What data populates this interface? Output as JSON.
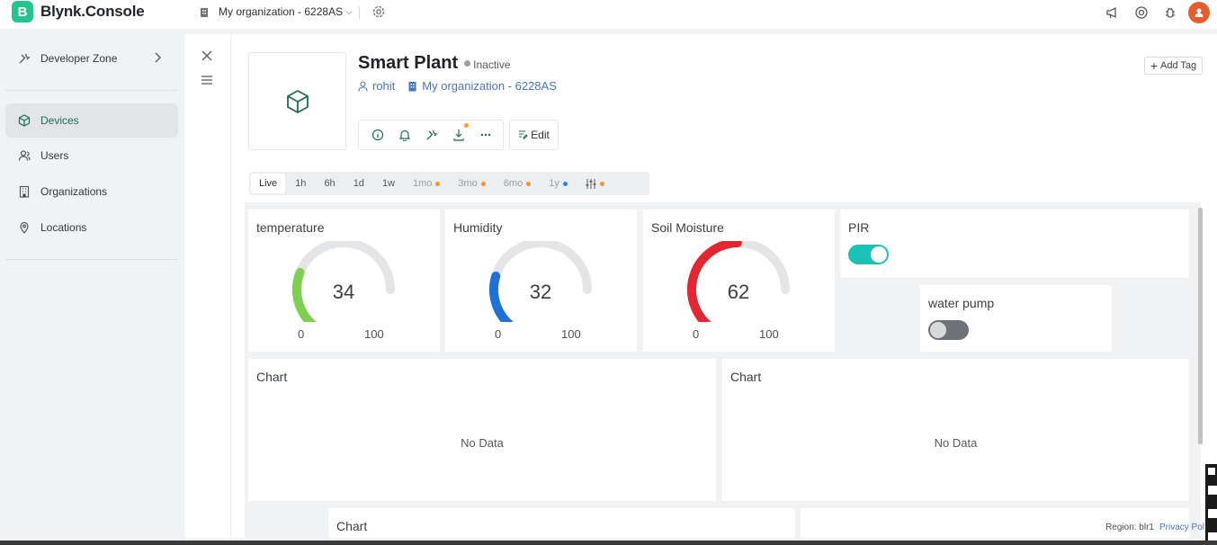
{
  "app": {
    "logo_letter": "B",
    "name": "Blynk.Console"
  },
  "topbar": {
    "organization": "My organization - 6228AS"
  },
  "sidebar": {
    "developer_zone": "Developer Zone",
    "items": [
      {
        "label": "Devices",
        "active": true
      },
      {
        "label": "Users"
      },
      {
        "label": "Organizations"
      },
      {
        "label": "Locations"
      }
    ]
  },
  "device": {
    "name": "Smart Plant",
    "status": "Inactive",
    "owner": "rohit",
    "organization": "My organization - 6228AS",
    "edit_label": "Edit",
    "add_tag_label": "Add Tag"
  },
  "time_tabs": [
    {
      "label": "Live",
      "active": true
    },
    {
      "label": "1h"
    },
    {
      "label": "6h"
    },
    {
      "label": "1d"
    },
    {
      "label": "1w"
    },
    {
      "label": "1mo",
      "dot": "#f0962a",
      "dim": true
    },
    {
      "label": "3mo",
      "dot": "#f0962a",
      "dim": true
    },
    {
      "label": "6mo",
      "dot": "#f0962a",
      "dim": true
    },
    {
      "label": "1y",
      "dot": "#2f80ed",
      "dim": true
    }
  ],
  "widgets": {
    "temperature": {
      "title": "temperature",
      "value": 34,
      "min": "0",
      "max": "100",
      "color": "#7ed050"
    },
    "humidity": {
      "title": "Humidity",
      "value": 32,
      "min": "0",
      "max": "100",
      "color": "#1f72d3"
    },
    "soil": {
      "title": "Soil Moisture",
      "value": 62,
      "min": "0",
      "max": "100",
      "color": "#e22733"
    },
    "pir": {
      "title": "PIR",
      "on": true,
      "color": "#1cc1b6"
    },
    "pump": {
      "title": "water pump",
      "on": false,
      "color": "#6f7276"
    },
    "chart1": {
      "title": "Chart",
      "empty": "No Data"
    },
    "chart2": {
      "title": "Chart",
      "empty": "No Data"
    },
    "chart3": {
      "title": "Chart"
    }
  },
  "footer": {
    "region": "Region: blr1",
    "privacy": "Privacy Pol"
  }
}
